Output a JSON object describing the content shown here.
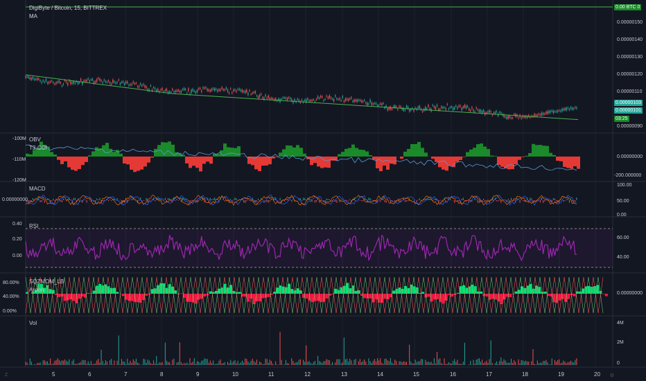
{
  "title": "DigiByte / Bitcoin, 15, BITTREX",
  "ma_label": "MA",
  "btc_tag": {
    "left": "0.00",
    "right": "BTC",
    "suffix": "0"
  },
  "price_tags": [
    "0.00000103",
    "0.00000101",
    "03:25"
  ],
  "panes": {
    "obv": {
      "label1": "OBV",
      "label2": "T3-CCI",
      "yticks": [
        "-100M",
        "-110M",
        "-120M"
      ],
      "right_ticks": [
        "0.00000000",
        "-200.000000"
      ]
    },
    "macd": {
      "label": "MACD",
      "left_tick": "0.00000000",
      "right_ticks": [
        "100.00",
        "50.00",
        "0.00"
      ]
    },
    "rsi": {
      "label": "RSI",
      "yticks": [
        "0.40",
        "0.20",
        "0.00"
      ],
      "right_ticks": [
        "60.00",
        "40.00"
      ]
    },
    "sqz": {
      "label1": "SQZMOM_LB",
      "label2": "Aroon",
      "yticks": [
        "80.00%",
        "40.00%",
        "0.00%"
      ],
      "right_ticks": [
        "0.00000000"
      ]
    },
    "vol": {
      "label": "Vol",
      "right_ticks": [
        "4M",
        "2M",
        "0"
      ]
    }
  },
  "price_axis_ticks": [
    "0.00000150",
    "0.00000140",
    "0.00000130",
    "0.00000120",
    "0.00000110",
    "0.00000090"
  ],
  "x_axis_ticks": [
    "5",
    "6",
    "7",
    "8",
    "9",
    "10",
    "11",
    "12",
    "13",
    "14",
    "15",
    "16",
    "17",
    "18",
    "19",
    "20"
  ],
  "colors": {
    "background": "#131722",
    "up": "#26a69a",
    "down": "#ef5350",
    "ma": "#4caf50",
    "rsi": "#9c27b0",
    "obv_pos": "#1b8a2a",
    "obv_neg": "#e53935"
  },
  "chart_data": {
    "type": "line",
    "series": [
      {
        "name": "MA",
        "values": [
          1.2,
          1.18,
          1.16,
          1.14,
          1.12,
          1.11,
          1.1,
          1.09,
          1.08,
          1.07,
          1.06,
          1.05,
          1.04,
          1.03,
          1.02,
          1.01
        ]
      }
    ],
    "ylim": [
      9e-07,
      1.55e-06
    ]
  }
}
